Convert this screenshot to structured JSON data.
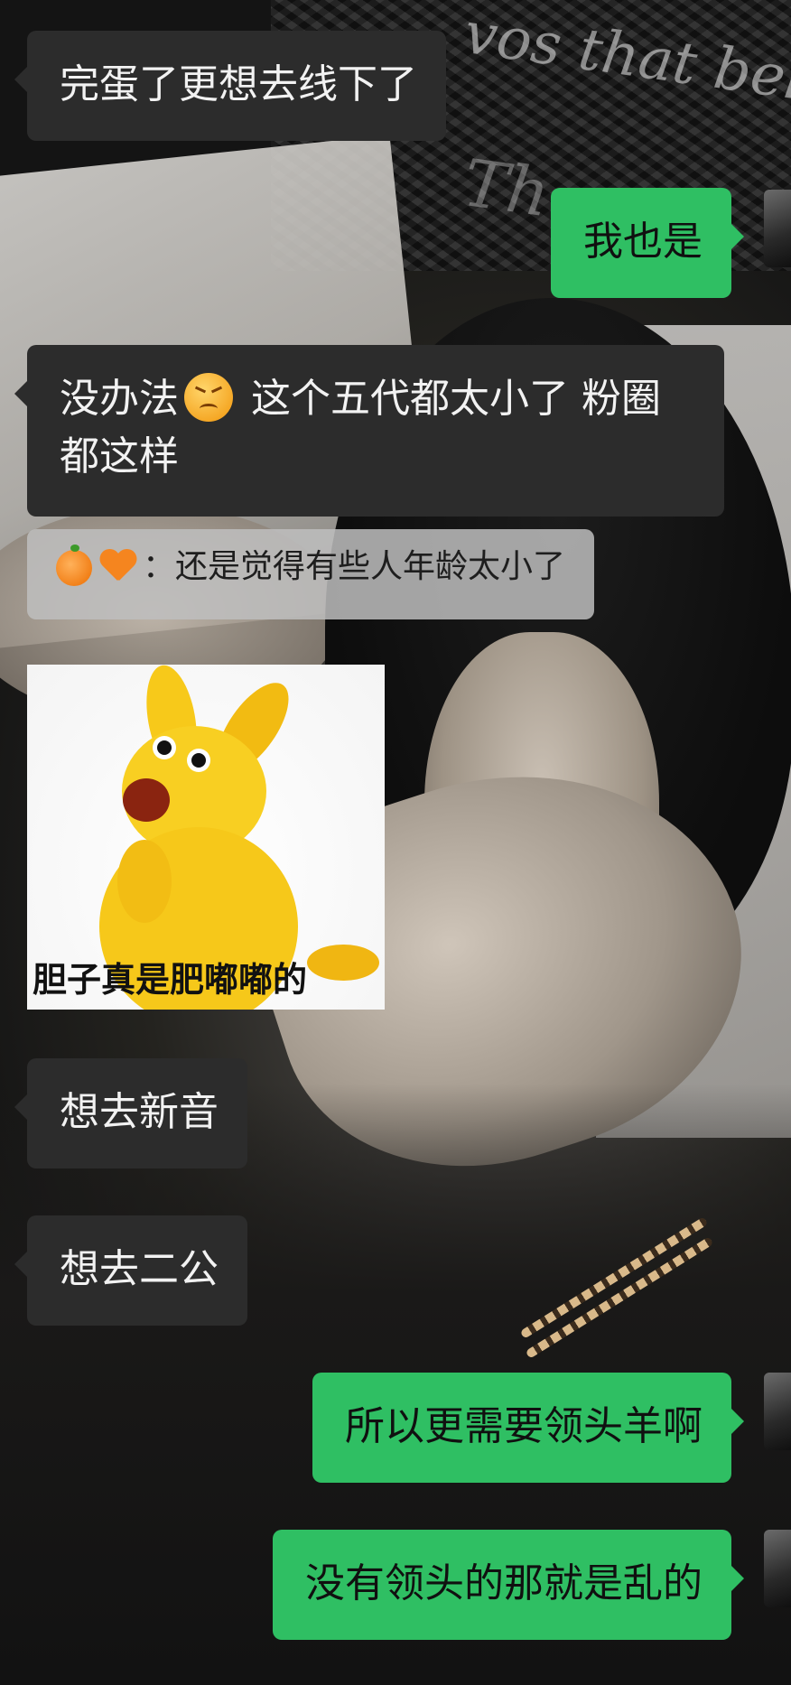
{
  "app": {
    "theme": {
      "sent_bubble_color": "#2fbf63",
      "received_bubble_color": "#2c2c2c",
      "quote_bubble_color": "#bebebe"
    }
  },
  "messages": [
    {
      "direction": "received",
      "type": "text",
      "text": "完蛋了更想去线下了"
    },
    {
      "direction": "sent",
      "type": "text",
      "text": "我也是"
    },
    {
      "direction": "received",
      "type": "text",
      "text_before_emoji": "没办法",
      "emoji": "confounded-face-emoji",
      "text_after_emoji": " 这个五代都太小了 粉圈都这样"
    },
    {
      "direction": "received",
      "type": "quote",
      "icons": [
        "tangerine-emoji",
        "orange-heart-emoji"
      ],
      "text": "：还是觉得有些人年龄太小了"
    },
    {
      "direction": "received",
      "type": "sticker",
      "icon": "yellow-kangaroo-sticker",
      "caption": "胆子真是肥嘟嘟的"
    },
    {
      "direction": "received",
      "type": "text",
      "text": "想去新音"
    },
    {
      "direction": "received",
      "type": "text",
      "text": "想去二公"
    },
    {
      "direction": "sent",
      "type": "text",
      "text": "所以更需要领头羊啊"
    },
    {
      "direction": "sent",
      "type": "text",
      "text": "没有领头的那就是乱的"
    }
  ],
  "wallpaper": {
    "script_text_1": "vos that belong",
    "script_text_2": "Th..."
  }
}
